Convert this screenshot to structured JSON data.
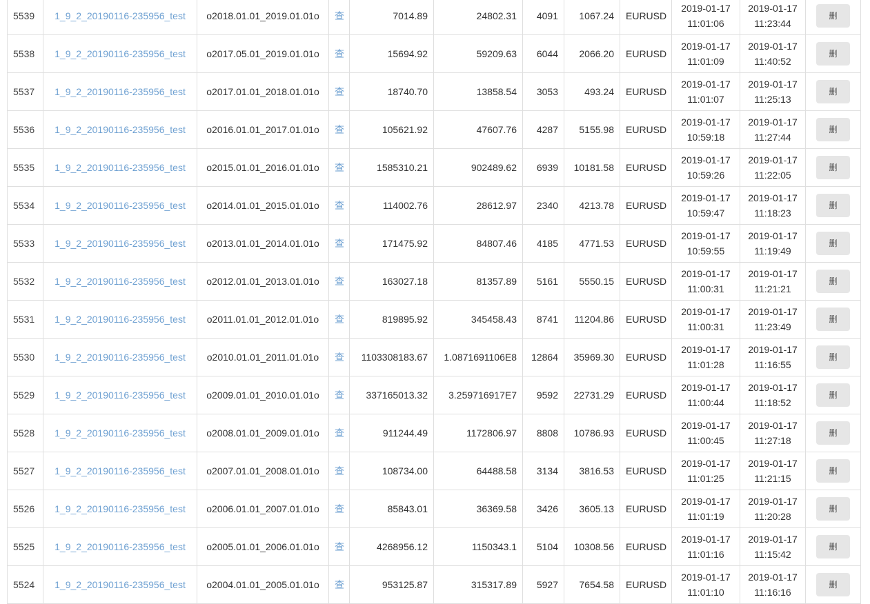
{
  "table": {
    "view_action_label": "查",
    "delete_action_label": "删",
    "rows": [
      {
        "id": "5539",
        "name": "1_9_2_20190116-235956_test",
        "range": "o2018.01.01_2019.01.01o",
        "num1": "7014.89",
        "num2": "24802.31",
        "num3": "4091",
        "num4": "1067.24",
        "symbol": "EURUSD",
        "time1": {
          "date": "2019-01-17",
          "time": "11:01:06"
        },
        "time2": {
          "date": "2019-01-17",
          "time": "11:23:44"
        }
      },
      {
        "id": "5538",
        "name": "1_9_2_20190116-235956_test",
        "range": "o2017.05.01_2019.01.01o",
        "num1": "15694.92",
        "num2": "59209.63",
        "num3": "6044",
        "num4": "2066.20",
        "symbol": "EURUSD",
        "time1": {
          "date": "2019-01-17",
          "time": "11:01:09"
        },
        "time2": {
          "date": "2019-01-17",
          "time": "11:40:52"
        }
      },
      {
        "id": "5537",
        "name": "1_9_2_20190116-235956_test",
        "range": "o2017.01.01_2018.01.01o",
        "num1": "18740.70",
        "num2": "13858.54",
        "num3": "3053",
        "num4": "493.24",
        "symbol": "EURUSD",
        "time1": {
          "date": "2019-01-17",
          "time": "11:01:07"
        },
        "time2": {
          "date": "2019-01-17",
          "time": "11:25:13"
        }
      },
      {
        "id": "5536",
        "name": "1_9_2_20190116-235956_test",
        "range": "o2016.01.01_2017.01.01o",
        "num1": "105621.92",
        "num2": "47607.76",
        "num3": "4287",
        "num4": "5155.98",
        "symbol": "EURUSD",
        "time1": {
          "date": "2019-01-17",
          "time": "10:59:18"
        },
        "time2": {
          "date": "2019-01-17",
          "time": "11:27:44"
        }
      },
      {
        "id": "5535",
        "name": "1_9_2_20190116-235956_test",
        "range": "o2015.01.01_2016.01.01o",
        "num1": "1585310.21",
        "num2": "902489.62",
        "num3": "6939",
        "num4": "10181.58",
        "symbol": "EURUSD",
        "time1": {
          "date": "2019-01-17",
          "time": "10:59:26"
        },
        "time2": {
          "date": "2019-01-17",
          "time": "11:22:05"
        }
      },
      {
        "id": "5534",
        "name": "1_9_2_20190116-235956_test",
        "range": "o2014.01.01_2015.01.01o",
        "num1": "114002.76",
        "num2": "28612.97",
        "num3": "2340",
        "num4": "4213.78",
        "symbol": "EURUSD",
        "time1": {
          "date": "2019-01-17",
          "time": "10:59:47"
        },
        "time2": {
          "date": "2019-01-17",
          "time": "11:18:23"
        }
      },
      {
        "id": "5533",
        "name": "1_9_2_20190116-235956_test",
        "range": "o2013.01.01_2014.01.01o",
        "num1": "171475.92",
        "num2": "84807.46",
        "num3": "4185",
        "num4": "4771.53",
        "symbol": "EURUSD",
        "time1": {
          "date": "2019-01-17",
          "time": "10:59:55"
        },
        "time2": {
          "date": "2019-01-17",
          "time": "11:19:49"
        }
      },
      {
        "id": "5532",
        "name": "1_9_2_20190116-235956_test",
        "range": "o2012.01.01_2013.01.01o",
        "num1": "163027.18",
        "num2": "81357.89",
        "num3": "5161",
        "num4": "5550.15",
        "symbol": "EURUSD",
        "time1": {
          "date": "2019-01-17",
          "time": "11:00:31"
        },
        "time2": {
          "date": "2019-01-17",
          "time": "11:21:21"
        }
      },
      {
        "id": "5531",
        "name": "1_9_2_20190116-235956_test",
        "range": "o2011.01.01_2012.01.01o",
        "num1": "819895.92",
        "num2": "345458.43",
        "num3": "8741",
        "num4": "11204.86",
        "symbol": "EURUSD",
        "time1": {
          "date": "2019-01-17",
          "time": "11:00:31"
        },
        "time2": {
          "date": "2019-01-17",
          "time": "11:23:49"
        }
      },
      {
        "id": "5530",
        "name": "1_9_2_20190116-235956_test",
        "range": "o2010.01.01_2011.01.01o",
        "num1": "1103308183.67",
        "num2": "1.0871691106E8",
        "num3": "12864",
        "num4": "35969.30",
        "symbol": "EURUSD",
        "time1": {
          "date": "2019-01-17",
          "time": "11:01:28"
        },
        "time2": {
          "date": "2019-01-17",
          "time": "11:16:55"
        }
      },
      {
        "id": "5529",
        "name": "1_9_2_20190116-235956_test",
        "range": "o2009.01.01_2010.01.01o",
        "num1": "337165013.32",
        "num2": "3.259716917E7",
        "num3": "9592",
        "num4": "22731.29",
        "symbol": "EURUSD",
        "time1": {
          "date": "2019-01-17",
          "time": "11:00:44"
        },
        "time2": {
          "date": "2019-01-17",
          "time": "11:18:52"
        }
      },
      {
        "id": "5528",
        "name": "1_9_2_20190116-235956_test",
        "range": "o2008.01.01_2009.01.01o",
        "num1": "911244.49",
        "num2": "1172806.97",
        "num3": "8808",
        "num4": "10786.93",
        "symbol": "EURUSD",
        "time1": {
          "date": "2019-01-17",
          "time": "11:00:45"
        },
        "time2": {
          "date": "2019-01-17",
          "time": "11:27:18"
        }
      },
      {
        "id": "5527",
        "name": "1_9_2_20190116-235956_test",
        "range": "o2007.01.01_2008.01.01o",
        "num1": "108734.00",
        "num2": "64488.58",
        "num3": "3134",
        "num4": "3816.53",
        "symbol": "EURUSD",
        "time1": {
          "date": "2019-01-17",
          "time": "11:01:25"
        },
        "time2": {
          "date": "2019-01-17",
          "time": "11:21:15"
        }
      },
      {
        "id": "5526",
        "name": "1_9_2_20190116-235956_test",
        "range": "o2006.01.01_2007.01.01o",
        "num1": "85843.01",
        "num2": "36369.58",
        "num3": "3426",
        "num4": "3605.13",
        "symbol": "EURUSD",
        "time1": {
          "date": "2019-01-17",
          "time": "11:01:19"
        },
        "time2": {
          "date": "2019-01-17",
          "time": "11:20:28"
        }
      },
      {
        "id": "5525",
        "name": "1_9_2_20190116-235956_test",
        "range": "o2005.01.01_2006.01.01o",
        "num1": "4268956.12",
        "num2": "1150343.1",
        "num3": "5104",
        "num4": "10308.56",
        "symbol": "EURUSD",
        "time1": {
          "date": "2019-01-17",
          "time": "11:01:16"
        },
        "time2": {
          "date": "2019-01-17",
          "time": "11:15:42"
        }
      },
      {
        "id": "5524",
        "name": "1_9_2_20190116-235956_test",
        "range": "o2004.01.01_2005.01.01o",
        "num1": "953125.87",
        "num2": "315317.89",
        "num3": "5927",
        "num4": "7654.58",
        "symbol": "EURUSD",
        "time1": {
          "date": "2019-01-17",
          "time": "11:01:10"
        },
        "time2": {
          "date": "2019-01-17",
          "time": "11:16:16"
        }
      }
    ]
  },
  "colors": {
    "link_blue": "#6fa1d2",
    "text": "#333333",
    "border": "#dfdfdf",
    "button_bg": "#e6e6e6",
    "button_text": "#555555",
    "row_bg": "#ffffff"
  }
}
